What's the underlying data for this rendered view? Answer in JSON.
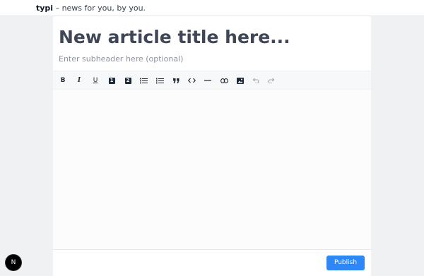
{
  "header": {
    "brand_name": "typi",
    "tagline": " – news for you, by you."
  },
  "editor": {
    "title_placeholder": "New article title here...",
    "subheader_placeholder": "Enter subheader here (optional)"
  },
  "toolbar": {
    "buttons": [
      {
        "name": "bold",
        "icon": "bold-icon",
        "glyph": "B"
      },
      {
        "name": "italic",
        "icon": "italic-icon",
        "glyph": "I"
      },
      {
        "name": "underline",
        "icon": "underline-icon",
        "glyph": "U"
      },
      {
        "name": "heading-1",
        "icon": "heading-1-icon",
        "glyph": "1"
      },
      {
        "name": "heading-2",
        "icon": "heading-2-icon",
        "glyph": "2"
      },
      {
        "name": "bullet-list",
        "icon": "bullet-list-icon"
      },
      {
        "name": "ordered-list",
        "icon": "ordered-list-icon"
      },
      {
        "name": "blockquote",
        "icon": "quote-icon"
      },
      {
        "name": "code",
        "icon": "code-icon"
      },
      {
        "name": "horizontal-rule",
        "icon": "horizontal-rule-icon"
      },
      {
        "name": "link",
        "icon": "link-icon"
      },
      {
        "name": "image",
        "icon": "image-icon"
      },
      {
        "name": "undo",
        "icon": "undo-icon"
      },
      {
        "name": "redo",
        "icon": "redo-icon"
      }
    ]
  },
  "footer": {
    "publish_label": "Publish"
  },
  "dev_badge": {
    "letter": "N",
    "icon": "nextjs-icon"
  },
  "colors": {
    "accent": "#2f86f6",
    "page_background": "#f0f1f2",
    "title_text": "#3f4756",
    "placeholder_text": "#8b93a1"
  }
}
